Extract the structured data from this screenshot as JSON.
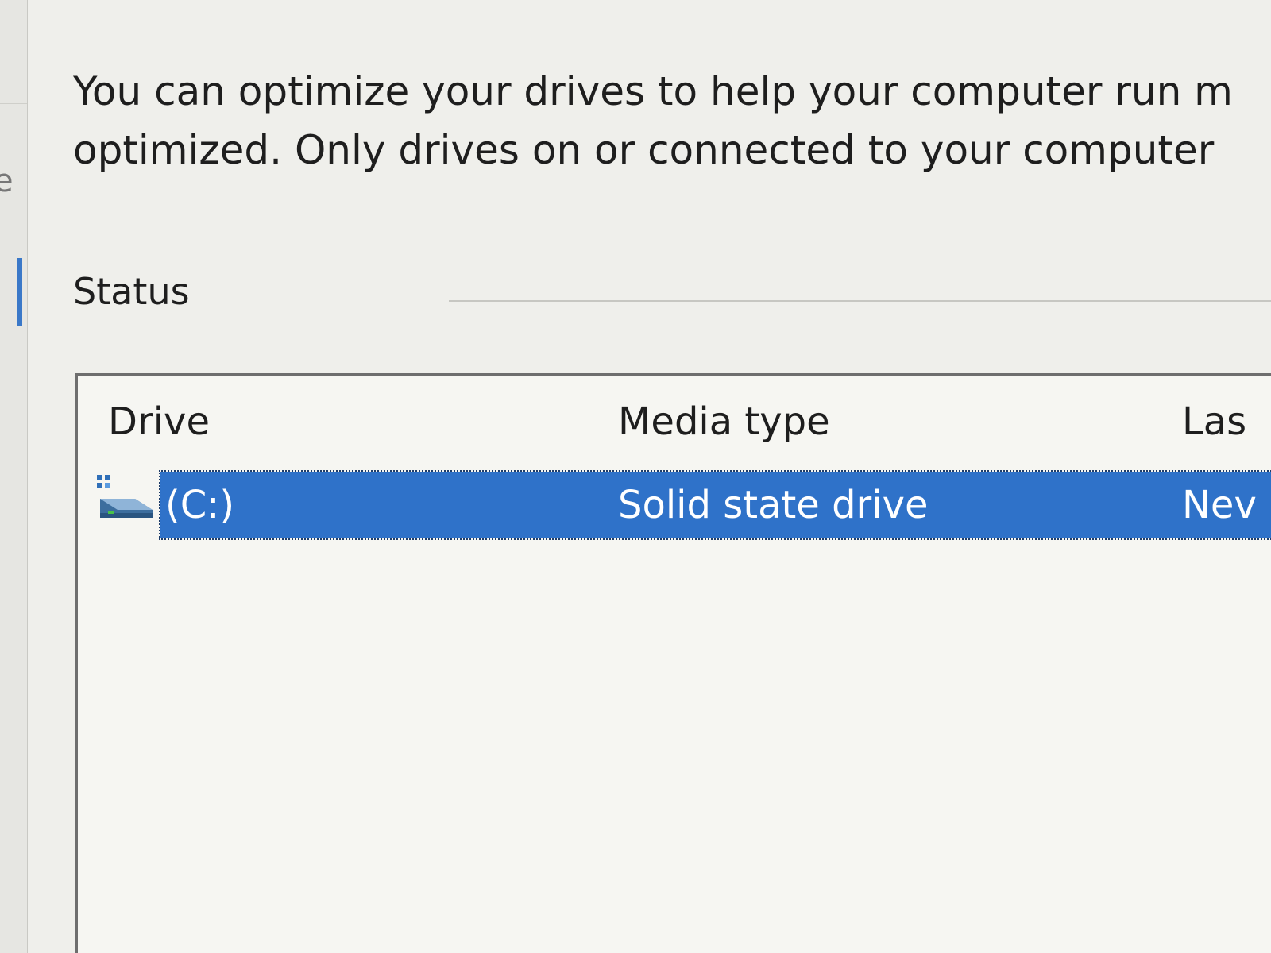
{
  "window": {
    "description_line1": "You can optimize your drives to help your computer run m",
    "description_line2": "optimized. Only drives on or connected to your computer"
  },
  "status": {
    "heading": "Status"
  },
  "table": {
    "columns": [
      "Drive",
      "Media type",
      "Las"
    ],
    "rows": [
      {
        "drive": "(C:)",
        "media_type": "Solid state drive",
        "last": "Nev",
        "selected": true
      }
    ]
  },
  "colors": {
    "selection": "#2f72c9",
    "text": "#1e1e1e",
    "background": "#efefeb"
  },
  "icons": {
    "drive_icon": "drive-icon"
  }
}
